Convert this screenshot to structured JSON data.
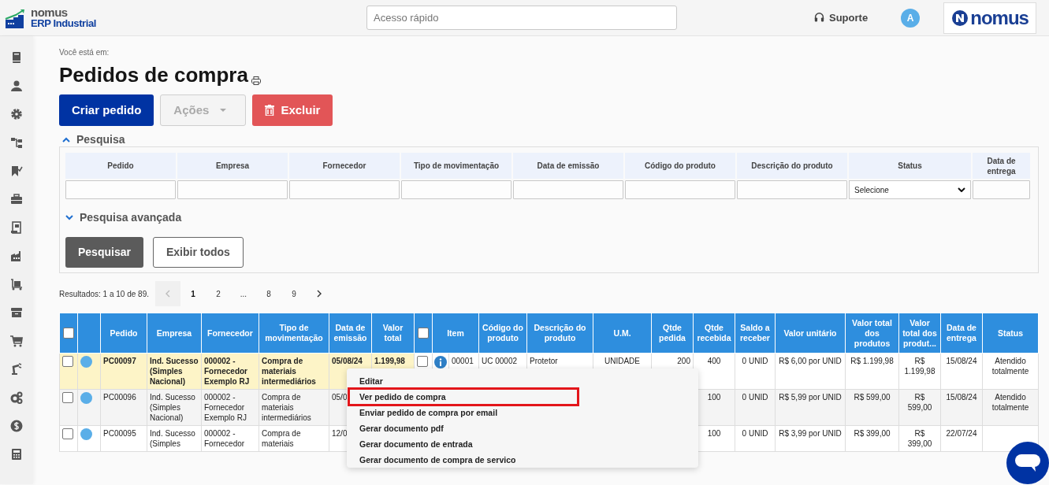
{
  "header": {
    "logo_line_1": "nomus",
    "logo_line_2": "ERP Industrial",
    "search": {
      "placeholder": "Acesso rápido"
    },
    "support": "Suporte",
    "avatar": "A",
    "brand": "nomus"
  },
  "sidebar": {
    "items": [
      {
        "kind": "book"
      },
      {
        "kind": "user"
      },
      {
        "kind": "gear"
      },
      {
        "kind": "hierarchy"
      },
      {
        "kind": "bookmark"
      },
      {
        "kind": "briefcase"
      },
      {
        "kind": "document"
      },
      {
        "kind": "factory"
      },
      {
        "kind": "dolly"
      },
      {
        "kind": "archive"
      },
      {
        "kind": "cart"
      },
      {
        "kind": "robot"
      },
      {
        "kind": "gears"
      },
      {
        "kind": "dollar"
      },
      {
        "kind": "calculator"
      }
    ]
  },
  "breadcrumb": "Você está em:",
  "title": "Pedidos de compra",
  "actions": [
    {
      "label": "Criar pedido",
      "kind": "primary",
      "disabled": false
    },
    {
      "label": "Ações",
      "kind": "dropdown",
      "disabled": true
    },
    {
      "label": "Excluir",
      "kind": "danger",
      "disabled": false
    }
  ],
  "search_panel": {
    "title": "Pesquisa",
    "expanded": true,
    "filters": [
      {
        "label": "Pedido",
        "kind": "text"
      },
      {
        "label": "Empresa",
        "kind": "text"
      },
      {
        "label": "Fornecedor",
        "kind": "text"
      },
      {
        "label": "Tipo de movimentação",
        "kind": "text"
      },
      {
        "label": "Data de emissão",
        "kind": "text"
      },
      {
        "label": "Código do produto",
        "kind": "text"
      },
      {
        "label": "Descrição do produto",
        "kind": "text"
      },
      {
        "label": "Status",
        "kind": "select",
        "value": "Selecione"
      },
      {
        "label": "Data de entrega",
        "kind": "text"
      }
    ],
    "advanced": {
      "title": "Pesquisa avançada",
      "expanded": false
    },
    "buttons": [
      {
        "label": "Pesquisar",
        "kind": "primary"
      },
      {
        "label": "Exibir todos",
        "kind": "outline"
      }
    ]
  },
  "results": "Resultados: 1 a 10 de 89.",
  "pagination": [
    {
      "kind": "prev",
      "disabled": true
    },
    {
      "kind": "page",
      "label": "1",
      "selected": true
    },
    {
      "kind": "page",
      "label": "2",
      "selected": false
    },
    {
      "kind": "ellipsis",
      "label": "..."
    },
    {
      "kind": "page",
      "label": "8",
      "selected": false
    },
    {
      "kind": "page",
      "label": "9",
      "selected": false
    },
    {
      "kind": "next",
      "disabled": false
    }
  ],
  "table": {
    "select_all_checked": false,
    "items_all_checked": false,
    "columns": [
      {
        "label": "Pedido"
      },
      {
        "label": "Empresa"
      },
      {
        "label": "Fornecedor"
      },
      {
        "label": "Tipo de movimentação"
      },
      {
        "label": "Data de emissão"
      },
      {
        "label": "Valor total"
      },
      {
        "label": "Item",
        "kind": "item"
      },
      {
        "label": "Código do produto"
      },
      {
        "label": "Descrição do produto"
      },
      {
        "label": "U.M."
      },
      {
        "label": "Qtde pedida"
      },
      {
        "label": "Qtde recebida"
      },
      {
        "label": "Saldo a receber"
      },
      {
        "label": "Valor unitário"
      },
      {
        "label": "Valor total dos produtos"
      },
      {
        "label": "Valor total dos produt..."
      },
      {
        "label": "Data de entrega"
      },
      {
        "label": "Status"
      }
    ],
    "rows": [
      {
        "checked": false,
        "selected": true,
        "color": "#5aaee8",
        "item_checked": false,
        "info": true,
        "cells": [
          "PC00097",
          "Ind. Sucesso (Simples Nacional)",
          "000002 - Fornecedor Exemplo RJ",
          "Compra de materiais intermediários",
          "05/08/24",
          "1.199,98",
          "00001",
          "UC 00002",
          "Protetor",
          "UNIDADE",
          "200",
          "400",
          "0 UNID",
          "R$ 6,00 por UNID",
          "R$ 1.199,98",
          "R$ 1.199,98",
          "15/08/24",
          "Atendido totalmente"
        ]
      },
      {
        "checked": false,
        "selected": false,
        "color": "#5aaee8",
        "cells": [
          "PC00096",
          "Ind. Sucesso (Simples Nacional)",
          "000002 - Fornecedor Exemplo RJ",
          "Compra de materiais intermediários",
          "05/0",
          null,
          null,
          null,
          null,
          null,
          null,
          "100",
          "0 UNID",
          "R$ 5,99 por UNID",
          "R$ 599,00",
          "R$ 599,00",
          "15/08/24",
          "Atendido totalmente"
        ]
      },
      {
        "checked": false,
        "selected": false,
        "color": "#5aaee8",
        "cells": [
          "PC00095",
          "Ind. Sucesso (Simples",
          "000002 - Fornecedor",
          "Compra de materiais",
          "12/0",
          null,
          null,
          null,
          null,
          null,
          null,
          "100",
          "0 UNID",
          "R$ 3,99 por UNID",
          "R$ 399,00",
          "R$ 399,00",
          "22/07/24",
          null
        ]
      }
    ]
  },
  "context_menu": {
    "items": [
      {
        "label": "Editar",
        "highlighted": false
      },
      {
        "label": "Ver pedido de compra",
        "highlighted": true
      },
      {
        "label": "Enviar pedido de compra por email",
        "highlighted": false
      },
      {
        "label": "Gerar documento pdf",
        "highlighted": false
      },
      {
        "label": "Gerar documento de entrada",
        "highlighted": false
      },
      {
        "label": "Gerar documento de compra de servico",
        "highlighted": false
      }
    ]
  }
}
